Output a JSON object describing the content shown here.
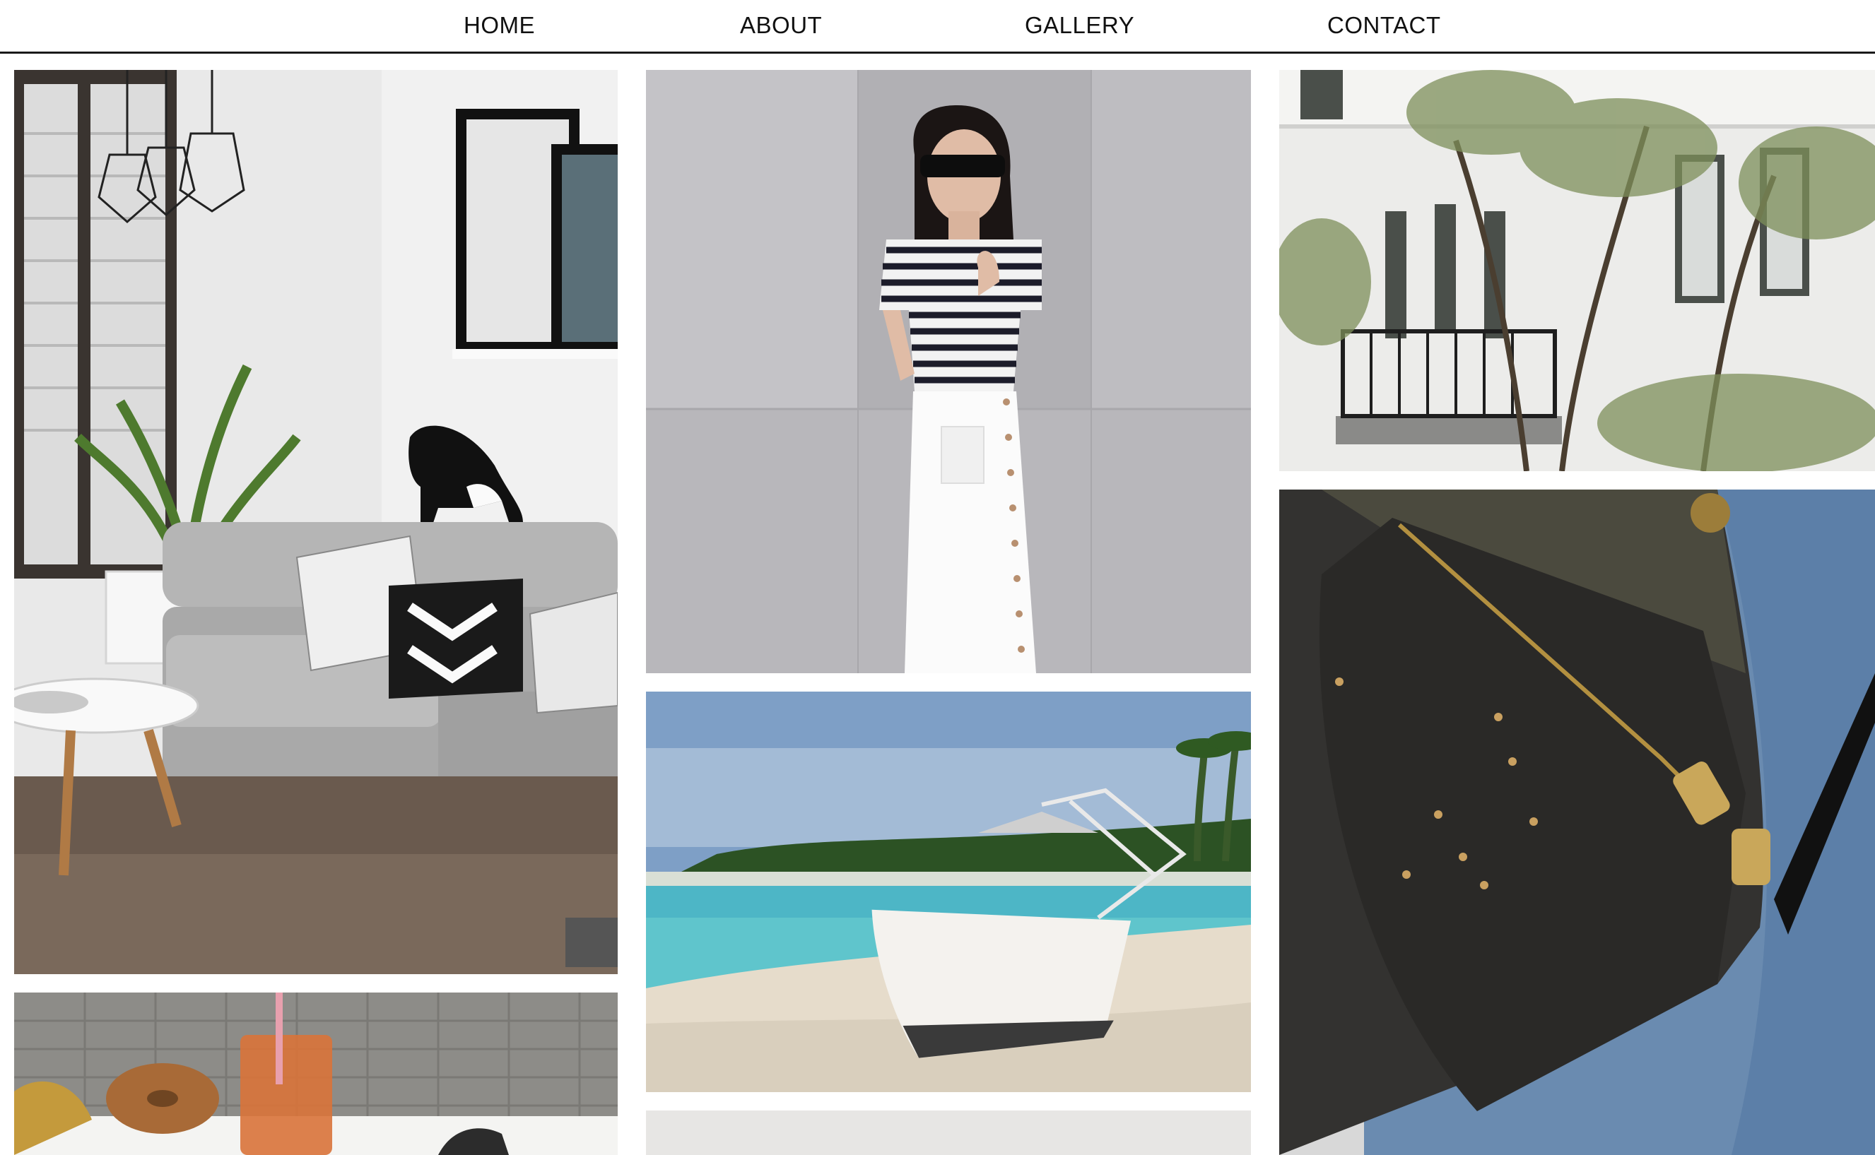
{
  "nav": {
    "items": [
      {
        "label": "HOME"
      },
      {
        "label": "ABOUT"
      },
      {
        "label": "GALLERY"
      },
      {
        "label": "CONTACT"
      }
    ]
  },
  "gallery": {
    "images": [
      {
        "subject": "living-room-with-cat"
      },
      {
        "subject": "breakfast-table"
      },
      {
        "subject": "woman-striped-shirt"
      },
      {
        "subject": "beached-boat"
      },
      {
        "subject": "partial-image"
      },
      {
        "subject": "white-building-balcony"
      },
      {
        "subject": "black-leather-bag"
      }
    ]
  },
  "colors": {
    "nav_text": "#111111",
    "nav_border": "#1a1a1a",
    "background": "#ffffff"
  }
}
